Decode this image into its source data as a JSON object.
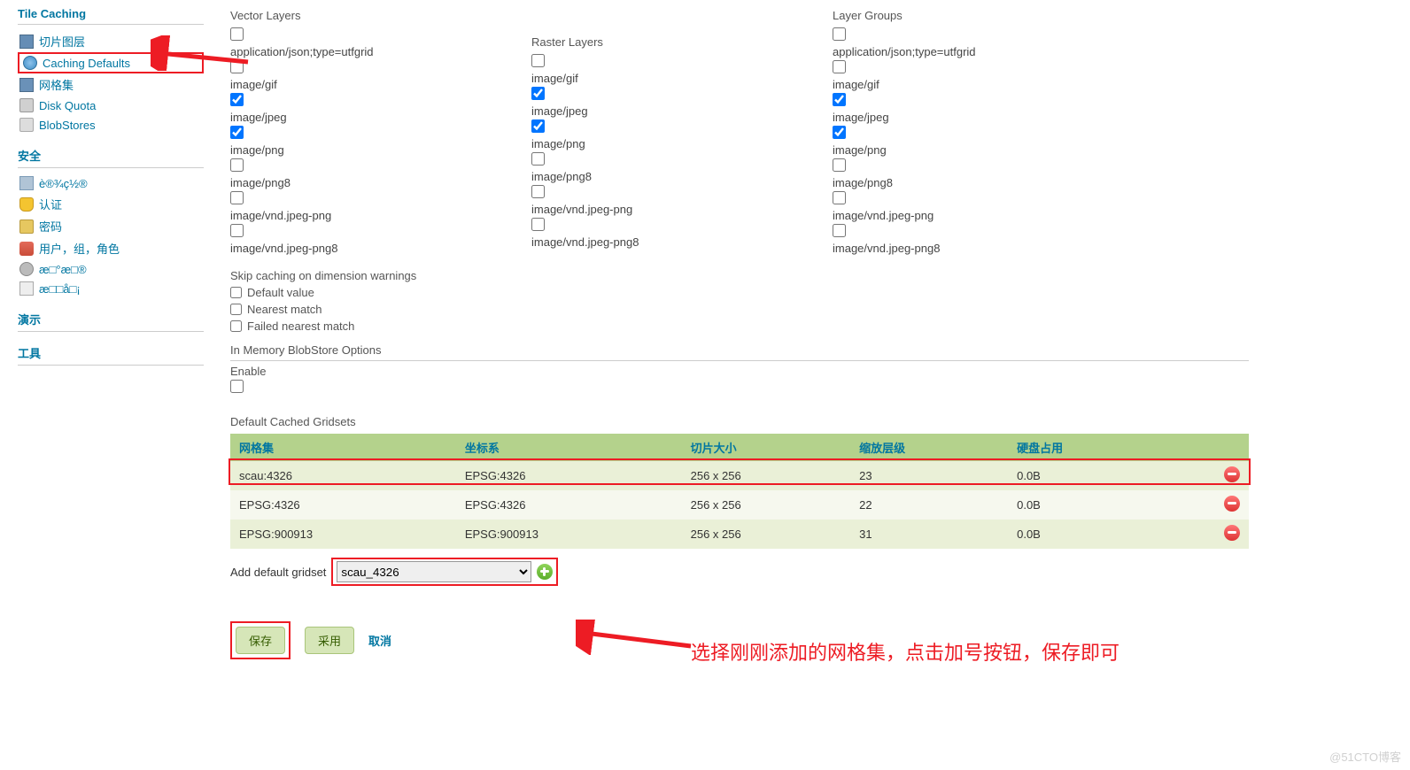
{
  "sidebar": {
    "tilecaching_title": "Tile Caching",
    "tc_items": [
      "切片图层",
      "Caching Defaults",
      "网格集",
      "Disk Quota",
      "BlobStores"
    ],
    "security_title": "安全",
    "sec_items": [
      "è®¾ç½®",
      "认证",
      "密码",
      "用户，组，角色",
      "æ□°æ□®",
      "æ□□å□¡"
    ],
    "demo_title": "演示",
    "tools_title": "工具"
  },
  "columns": {
    "vector_title": "Vector Layers",
    "raster_title": "Raster Layers",
    "group_title": "Layer Groups",
    "formats": [
      "application/json;type=utfgrid",
      "image/gif",
      "image/jpeg",
      "image/png",
      "image/png8",
      "image/vnd.jpeg-png",
      "image/vnd.jpeg-png8"
    ],
    "vector_checked": [
      false,
      false,
      true,
      true,
      false,
      false,
      false
    ],
    "raster_checked": [
      false,
      true,
      true,
      false,
      false,
      false
    ],
    "group_checked": [
      false,
      false,
      true,
      true,
      false,
      false,
      false
    ]
  },
  "raster_formats": [
    "image/gif",
    "image/jpeg",
    "image/png",
    "image/png8",
    "image/vnd.jpeg-png",
    "image/vnd.jpeg-png8"
  ],
  "skip": {
    "title": "Skip caching on dimension warnings",
    "items": [
      "Default value",
      "Nearest match",
      "Failed nearest match"
    ]
  },
  "memory": {
    "title": "In Memory BlobStore Options",
    "enable": "Enable"
  },
  "grid": {
    "title": "Default Cached Gridsets",
    "headers": [
      "网格集",
      "坐标系",
      "切片大小",
      "缩放层级",
      "硬盘占用"
    ],
    "rows": [
      {
        "g": "scau:4326",
        "c": "EPSG:4326",
        "s": "256 x 256",
        "z": "23",
        "d": "0.0B"
      },
      {
        "g": "EPSG:4326",
        "c": "EPSG:4326",
        "s": "256 x 256",
        "z": "22",
        "d": "0.0B"
      },
      {
        "g": "EPSG:900913",
        "c": "EPSG:900913",
        "s": "256 x 256",
        "z": "31",
        "d": "0.0B"
      }
    ],
    "addlabel": "Add default gridset",
    "selected": "scau_4326"
  },
  "buttons": {
    "save": "保存",
    "apply": "采用",
    "cancel": "取消"
  },
  "annotation": "选择刚刚添加的网格集，点击加号按钮，保存即可",
  "watermark": "@51CTO博客"
}
